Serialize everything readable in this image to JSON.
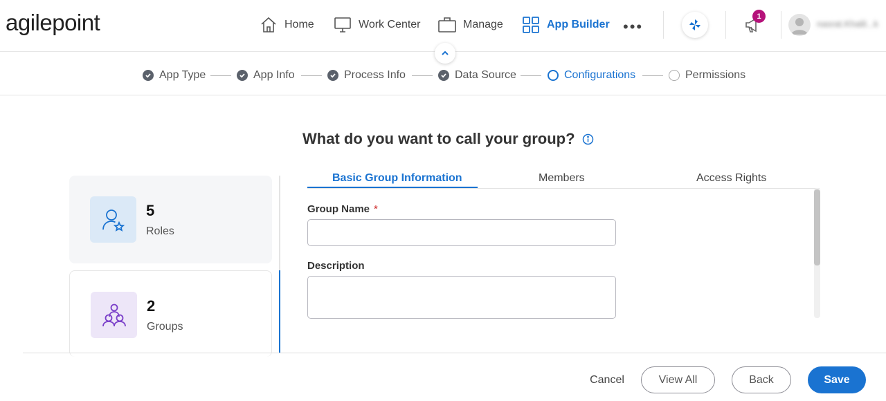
{
  "brand": {
    "logo": "agilepoint"
  },
  "nav": {
    "items": [
      {
        "label": "Home",
        "icon": "home-icon"
      },
      {
        "label": "Work Center",
        "icon": "monitor-icon"
      },
      {
        "label": "Manage",
        "icon": "briefcase-icon"
      },
      {
        "label": "App Builder",
        "icon": "grid-icon",
        "active": true
      }
    ],
    "more": "•••",
    "notifications_count": "1",
    "user_name": "nasrat.Khalil...k"
  },
  "stepper": {
    "steps": [
      {
        "label": "App Type",
        "status": "done"
      },
      {
        "label": "App Info",
        "status": "done"
      },
      {
        "label": "Process Info",
        "status": "done"
      },
      {
        "label": "Data Source",
        "status": "done"
      },
      {
        "label": "Configurations",
        "status": "current"
      },
      {
        "label": "Permissions",
        "status": "todo"
      }
    ]
  },
  "main": {
    "question": "What do you want to call your group?",
    "cards": [
      {
        "count": "5",
        "label": "Roles"
      },
      {
        "count": "2",
        "label": "Groups"
      }
    ],
    "tabs": [
      {
        "label": "Basic Group Information",
        "active": true
      },
      {
        "label": "Members"
      },
      {
        "label": "Access Rights"
      }
    ],
    "form": {
      "group_name_label": "Group Name",
      "required_mark": "*",
      "group_name_value": "",
      "description_label": "Description",
      "description_value": ""
    }
  },
  "footer": {
    "cancel": "Cancel",
    "view_all": "View All",
    "back": "Back",
    "save": "Save"
  },
  "colors": {
    "accent": "#1a73d1",
    "badge": "#b5127a",
    "done_dot": "#5b616b"
  }
}
